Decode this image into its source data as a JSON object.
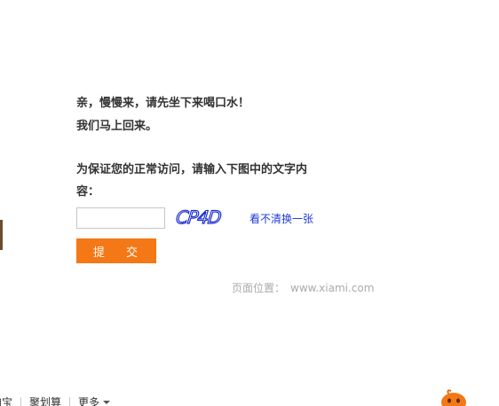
{
  "message": {
    "line1": "亲，慢慢来，请先坐下来喝口水！",
    "line2": "我们马上回来。",
    "line3": "为保证您的正常访问，请输入下图中的文字内",
    "line4": "容："
  },
  "captcha": {
    "input_value": "",
    "image_text": "CP4D",
    "refresh_label": "看不清换一张"
  },
  "submit_label": "提 交",
  "location": {
    "label": "页面位置：",
    "value": "www.xiami.com"
  },
  "footer": {
    "items": [
      "淘宝",
      "聚划算",
      "更多"
    ]
  },
  "colors": {
    "accent": "#f47815",
    "link": "#1f3bd6",
    "captcha_ink": "#1b2bd0",
    "text": "#333333",
    "muted": "#aaaaaa"
  },
  "icons": [
    "chevron-down-icon",
    "mascot-icon"
  ]
}
